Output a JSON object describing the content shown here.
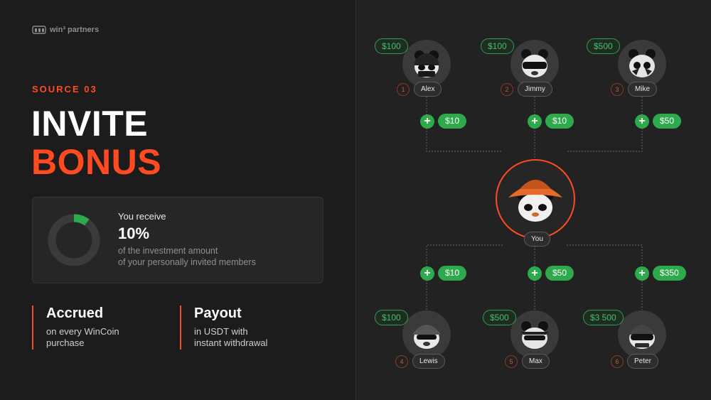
{
  "brand": {
    "name": "win³ partners"
  },
  "hero": {
    "eyebrow": "SOURCE 03",
    "title_line1": "INVITE",
    "title_line2": "BONUS"
  },
  "card": {
    "label": "You receive",
    "percent": "10%",
    "percent_value": 0.1,
    "description_line1": "of the investment amount",
    "description_line2": "of your personally invited members"
  },
  "features": [
    {
      "title": "Accrued",
      "line1": "on every WinCoin",
      "line2": "purchase"
    },
    {
      "title": "Payout",
      "line1": "in USDT with",
      "line2": "instant withdrawal"
    }
  ],
  "center": {
    "name": "You"
  },
  "top_members": [
    {
      "num": "1",
      "name": "Alex",
      "amount": "$100",
      "bonus": "$10"
    },
    {
      "num": "2",
      "name": "Jimmy",
      "amount": "$100",
      "bonus": "$10"
    },
    {
      "num": "3",
      "name": "Mike",
      "amount": "$500",
      "bonus": "$50"
    }
  ],
  "bottom_members": [
    {
      "num": "4",
      "name": "Lewis",
      "amount": "$100",
      "bonus": "$10"
    },
    {
      "num": "5",
      "name": "Max",
      "amount": "$500",
      "bonus": "$50"
    },
    {
      "num": "6",
      "name": "Peter",
      "amount": "$3 500",
      "bonus": "$350"
    }
  ],
  "colors": {
    "accent": "#ff4b1f",
    "green": "#2eaa4d",
    "bg": "#1c1c1c"
  }
}
